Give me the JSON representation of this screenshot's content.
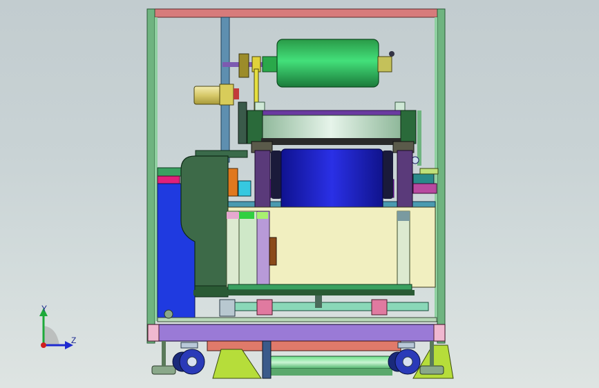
{
  "window": {
    "background": "#c9d3d5"
  },
  "triad": {
    "y_label": "Y",
    "z_label": "Z"
  },
  "colors": {
    "frame_green": "#5aa86c",
    "top_rail": "#d77b7b",
    "roller_green": "#2fc25a",
    "roller_blue": "#1e22c8",
    "cabinet_yellow": "#f2f0bd",
    "base_purple": "#9a7ad6",
    "foot_lime": "#b6dd3a"
  }
}
